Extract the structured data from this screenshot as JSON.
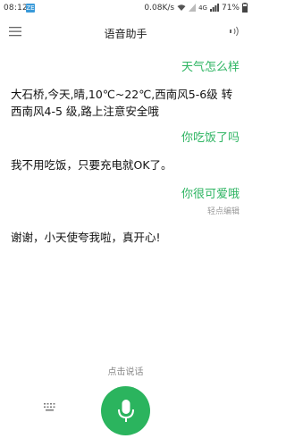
{
  "status_bar": {
    "time": "08:12",
    "notification_icon": "ZE",
    "net_speed": "0.08K/s",
    "network": "4G",
    "battery": "71%"
  },
  "header": {
    "title": "语音助手"
  },
  "conversation": [
    {
      "role": "user",
      "text": "天气怎么样"
    },
    {
      "role": "bot",
      "text": "大石桥,今天,晴,10℃~22℃,西南风5-6级 转 西南风4-5 级,路上注意安全哦"
    },
    {
      "role": "user",
      "text": "你吃饭了吗"
    },
    {
      "role": "bot",
      "text": "我不用吃饭，只要充电就OK了。"
    },
    {
      "role": "user",
      "text": "你很可爱哦"
    },
    {
      "role": "bot",
      "text": "谢谢，小天使夸我啦，真开心!"
    }
  ],
  "edit_hint": "轻点编辑",
  "bottom": {
    "tap_to_speak": "点击说话"
  },
  "colors": {
    "accent": "#2bb45e",
    "user_text": "#2fb563"
  },
  "icons": {
    "menu": "hamburger-menu-icon",
    "speaker": "speaker-icon",
    "keyboard": "keyboard-icon",
    "mic": "microphone-icon"
  }
}
